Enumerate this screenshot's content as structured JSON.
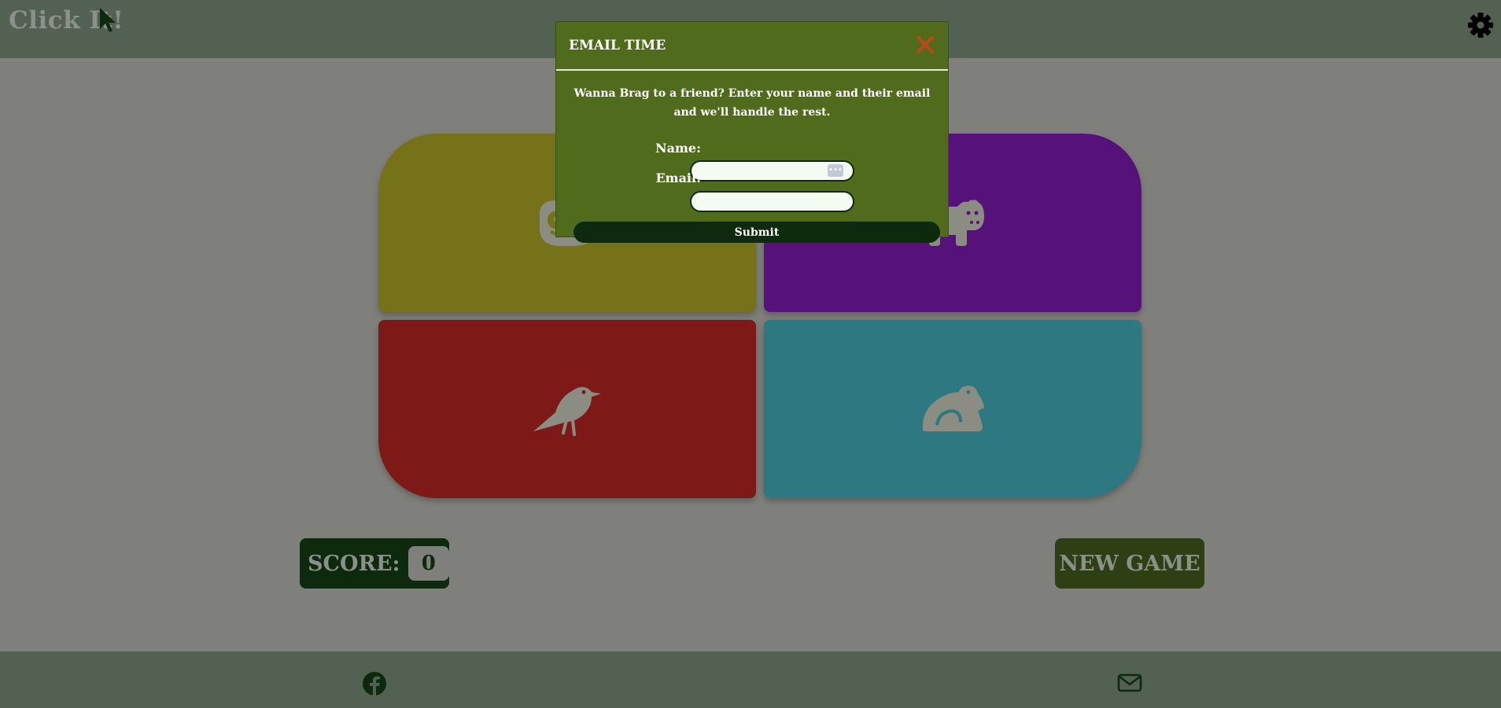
{
  "header": {
    "brand": "Click It!",
    "brand_icon": "cursor-icon",
    "settings_icon": "gear-icon"
  },
  "tiles": [
    {
      "animal": "sloth-icon",
      "color": "#75721a"
    },
    {
      "animal": "hippo-icon",
      "color": "#56117a"
    },
    {
      "animal": "crow-icon",
      "color": "#7d1a17"
    },
    {
      "animal": "frog-icon",
      "color": "#2e7882"
    }
  ],
  "score": {
    "label": "SCORE:",
    "value": "0"
  },
  "new_game": {
    "label": "NEW GAME"
  },
  "footer": {
    "facebook_icon": "facebook-icon",
    "email_icon": "envelope-icon"
  },
  "modal": {
    "title": "EMAIL TIME",
    "close_icon": "close-icon",
    "message": "Wanna Brag to a friend? Enter your name and their email and we'll handle the rest.",
    "name_label": "Name:",
    "name_value": "",
    "email_label": "Email:",
    "email_value": "",
    "submit_label": "Submit"
  },
  "colors": {
    "overlay_bg": "#7f807c",
    "header_bg": "#536152",
    "modal_bg": "#4f6b1b",
    "close": "#c2451b",
    "dark_green": "#0d2a0e",
    "new_game_bg": "#2f3f14"
  }
}
